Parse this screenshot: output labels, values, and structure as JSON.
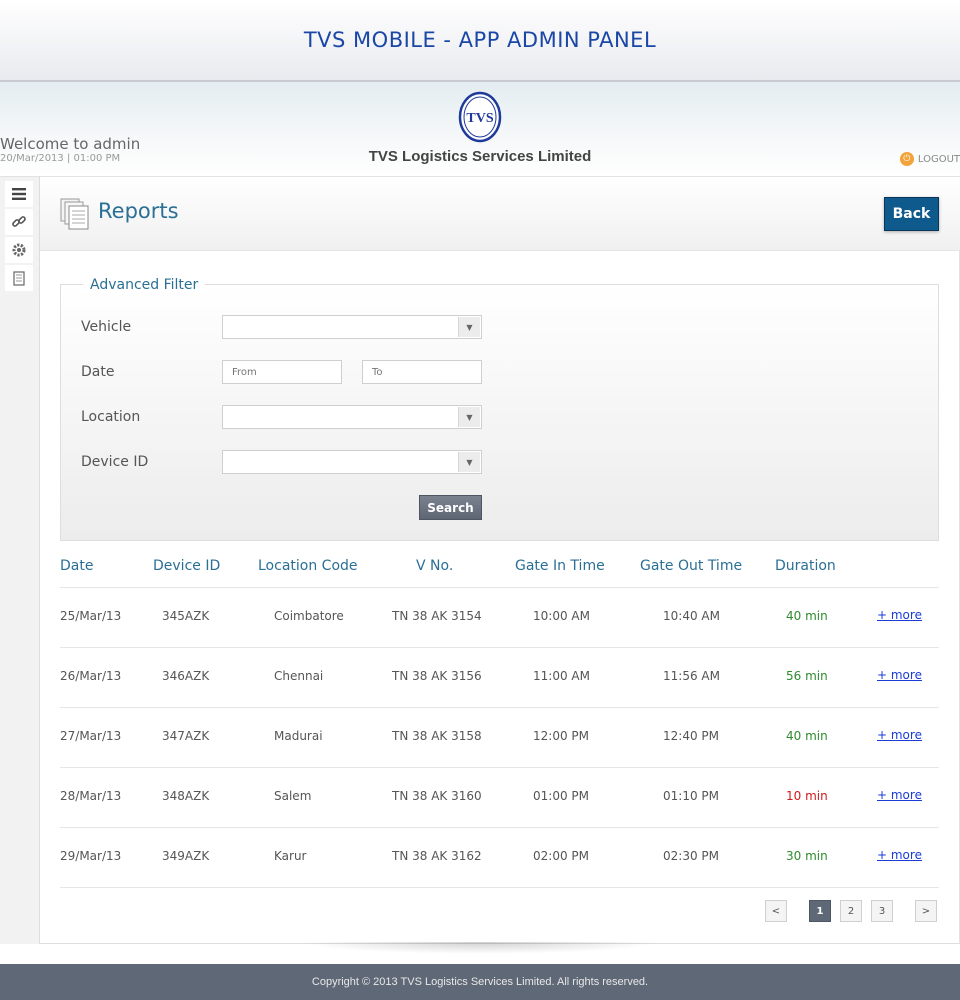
{
  "app": {
    "banner_title": "TVS MOBILE - APP ADMIN PANEL",
    "company": "TVS Logistics Services Limited",
    "logo_text": "TVS",
    "welcome": "Welcome to admin",
    "welcome_date": "20/Mar/2013 | 01:00 PM",
    "logout_label": "LOGOUT"
  },
  "sidebar": {
    "items": [
      {
        "icon": "menu-icon"
      },
      {
        "icon": "link-icon"
      },
      {
        "icon": "settings-icon"
      },
      {
        "icon": "document-icon"
      }
    ]
  },
  "page": {
    "title": "Reports",
    "back_label": "Back"
  },
  "filter": {
    "legend": "Advanced Filter",
    "vehicle_label": "Vehicle",
    "date_label": "Date",
    "from_placeholder": "From",
    "to_placeholder": "To",
    "location_label": "Location",
    "device_label": "Device ID",
    "search_label": "Search"
  },
  "table": {
    "headers": [
      "Date",
      "Device ID",
      "Location Code",
      "V No.",
      "Gate In Time",
      "Gate Out Time",
      "Duration"
    ],
    "more_label": "+ more",
    "rows": [
      {
        "date": "25/Mar/13",
        "device": "345AZK",
        "location": "Coimbatore",
        "vno": "TN 38 AK 3154",
        "gate_in": "10:00 AM",
        "gate_out": "10:40 AM",
        "duration": "40 min",
        "status_color": "#2e8b2e"
      },
      {
        "date": "26/Mar/13",
        "device": "346AZK",
        "location": "Chennai",
        "vno": "TN 38 AK 3156",
        "gate_in": "11:00 AM",
        "gate_out": "11:56 AM",
        "duration": "56 min",
        "status_color": "#2e8b2e"
      },
      {
        "date": "27/Mar/13",
        "device": "347AZK",
        "location": "Madurai",
        "vno": "TN 38 AK 3158",
        "gate_in": "12:00 PM",
        "gate_out": "12:40 PM",
        "duration": "40 min",
        "status_color": "#2e8b2e"
      },
      {
        "date": "28/Mar/13",
        "device": "348AZK",
        "location": "Salem",
        "vno": "TN 38 AK 3160",
        "gate_in": "01:00 PM",
        "gate_out": "01:10 PM",
        "duration": "10 min",
        "status_color": "#d11a1a"
      },
      {
        "date": "29/Mar/13",
        "device": "349AZK",
        "location": "Karur",
        "vno": "TN 38 AK 3162",
        "gate_in": "02:00 PM",
        "gate_out": "02:30 PM",
        "duration": "30 min",
        "status_color": "#2e8b2e"
      }
    ]
  },
  "pagination": {
    "prev": "<",
    "pages": [
      "1",
      "2",
      "3"
    ],
    "current": "1",
    "next": ">"
  },
  "footer": {
    "copyright": "Copyright © 2013 TVS Logistics Services Limited. All rights reserved."
  },
  "colors": {
    "accent": "#2a6f94",
    "banner_title": "#1a47a6",
    "back_button": "#0f5a8c",
    "footer_bg": "#5f6876"
  }
}
